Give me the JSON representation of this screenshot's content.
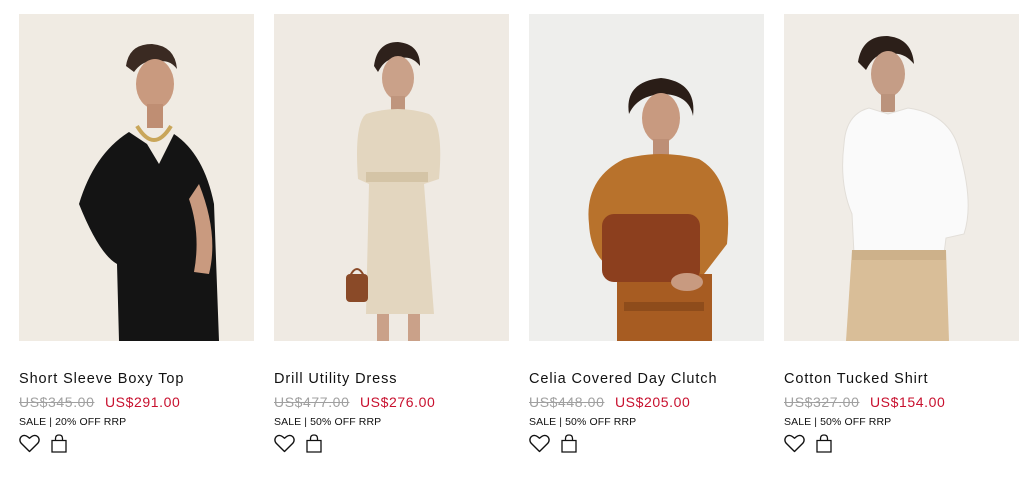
{
  "products": [
    {
      "name": "Short Sleeve Boxy Top",
      "old_price": "US$345.00",
      "sale_price": "US$291.00",
      "sale_tag": "SALE | 20% OFF RRP",
      "icons": [
        "heart-icon",
        "shopping-bag-icon"
      ],
      "colors": {
        "background": "#f0ebe3",
        "garment": "#141414",
        "skin": "#c99a7f"
      }
    },
    {
      "name": "Drill Utility Dress",
      "old_price": "US$477.00",
      "sale_price": "US$276.00",
      "sale_tag": "SALE | 50% OFF RRP",
      "icons": [
        "heart-icon",
        "shopping-bag-icon"
      ],
      "colors": {
        "background": "#efeae3",
        "garment": "#e3d6bf",
        "skin": "#caa189"
      }
    },
    {
      "name": "Celia Covered Day Clutch",
      "old_price": "US$448.00",
      "sale_price": "US$205.00",
      "sale_tag": "SALE | 50% OFF RRP",
      "icons": [
        "heart-icon",
        "shopping-bag-icon"
      ],
      "colors": {
        "background": "#eeeeec",
        "garment": "#b8722c",
        "skin": "#c89a80"
      }
    },
    {
      "name": "Cotton Tucked Shirt",
      "old_price": "US$327.00",
      "sale_price": "US$154.00",
      "sale_tag": "SALE | 50% OFF RRP",
      "icons": [
        "heart-icon",
        "shopping-bag-icon"
      ],
      "colors": {
        "background": "#f0ece6",
        "garment": "#fafafa",
        "skin": "#c59d86"
      }
    }
  ],
  "colors": {
    "sale_price": "#c8102e",
    "old_price": "#a0a0a0",
    "text": "#111111"
  }
}
